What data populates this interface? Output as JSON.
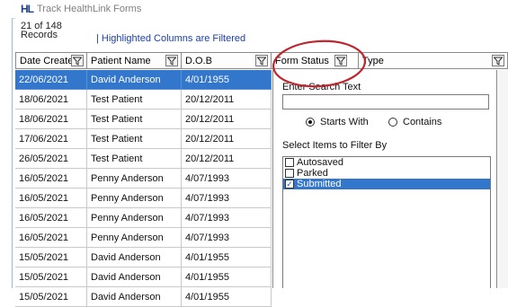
{
  "window": {
    "logo": "HL",
    "title": "Track HealthLink Forms"
  },
  "info": {
    "records": "21 of 148 Records",
    "filtered_note": "| Highlighted Columns are Filtered"
  },
  "columns": [
    {
      "label": "Date Created",
      "filter": true
    },
    {
      "label": "Patient Name",
      "filter": true
    },
    {
      "label": "D.O.B",
      "filter": true
    },
    {
      "label": "Form Status",
      "filter": true
    },
    {
      "label": "Type",
      "filter": true
    }
  ],
  "rows": [
    {
      "date": "22/06/2021",
      "name": "David Anderson",
      "dob": "4/01/1955",
      "selected": true
    },
    {
      "date": "18/06/2021",
      "name": "Test Patient",
      "dob": "20/12/2011"
    },
    {
      "date": "18/06/2021",
      "name": "Test Patient",
      "dob": "20/12/2011"
    },
    {
      "date": "17/06/2021",
      "name": "Test Patient",
      "dob": "20/12/2011"
    },
    {
      "date": "26/05/2021",
      "name": "Test Patient",
      "dob": "20/12/2011"
    },
    {
      "date": "16/05/2021",
      "name": "Penny Anderson",
      "dob": "4/07/1993"
    },
    {
      "date": "16/05/2021",
      "name": "Penny Anderson",
      "dob": "4/07/1993"
    },
    {
      "date": "16/05/2021",
      "name": "Penny Anderson",
      "dob": "4/07/1993"
    },
    {
      "date": "16/05/2021",
      "name": "Penny Anderson",
      "dob": "4/07/1993"
    },
    {
      "date": "15/05/2021",
      "name": "David Anderson",
      "dob": "4/01/1955"
    },
    {
      "date": "15/05/2021",
      "name": "David Anderson",
      "dob": "4/01/1955"
    },
    {
      "date": "15/05/2021",
      "name": "David Anderson",
      "dob": "4/01/1955"
    }
  ],
  "filter_panel": {
    "enter_label": "Enter Search Text",
    "search_value": "",
    "starts_with_label": "Starts With",
    "contains_label": "Contains",
    "selected_mode": "starts_with",
    "filter_by_label": "Select Items to Filter By",
    "items": [
      {
        "label": "Autosaved",
        "checked": false,
        "selected": false
      },
      {
        "label": "Parked",
        "checked": false,
        "selected": false
      },
      {
        "label": "Submitted",
        "checked": true,
        "selected": true
      }
    ]
  },
  "colors": {
    "selection": "#3377cc",
    "annotation": "#c0242c",
    "note_text": "#1c3fa6"
  }
}
